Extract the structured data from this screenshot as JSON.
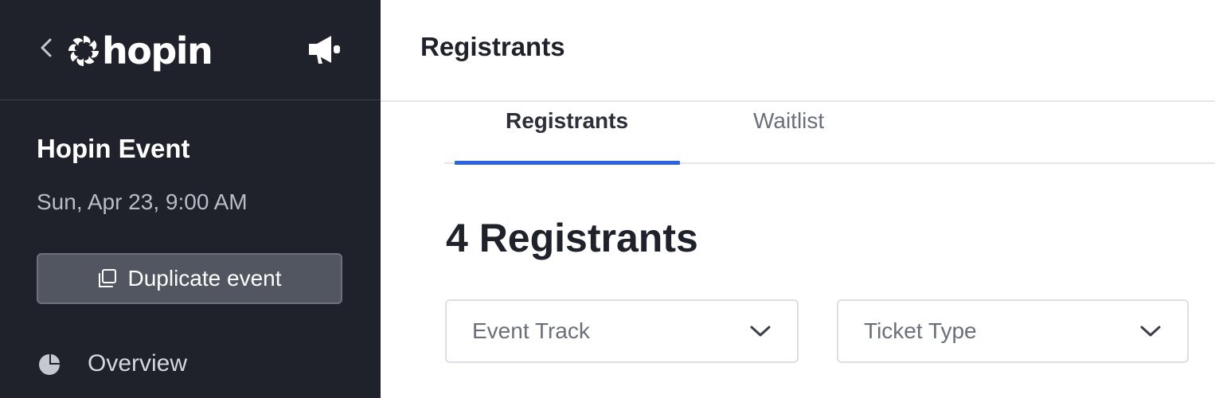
{
  "sidebar": {
    "logo_text": "hopin",
    "event_name": "Hopin Event",
    "event_date": "Sun, Apr 23, 9:00 AM",
    "duplicate_label": "Duplicate event",
    "nav": [
      {
        "label": "Overview",
        "icon": "pie-chart-icon"
      }
    ],
    "icons": {
      "back": "chevron-left-icon",
      "announce": "megaphone-icon",
      "duplicate": "copy-icon"
    }
  },
  "header": {
    "title": "Registrants"
  },
  "tabs": [
    {
      "label": "Registrants",
      "active": true
    },
    {
      "label": "Waitlist",
      "active": false
    }
  ],
  "content": {
    "count_heading": "4 Registrants",
    "filters": [
      {
        "placeholder": "Event Track"
      },
      {
        "placeholder": "Ticket Type"
      }
    ]
  },
  "colors": {
    "sidebar_bg": "#1f222b",
    "accent": "#2e62e0",
    "button_bg": "#525660"
  }
}
